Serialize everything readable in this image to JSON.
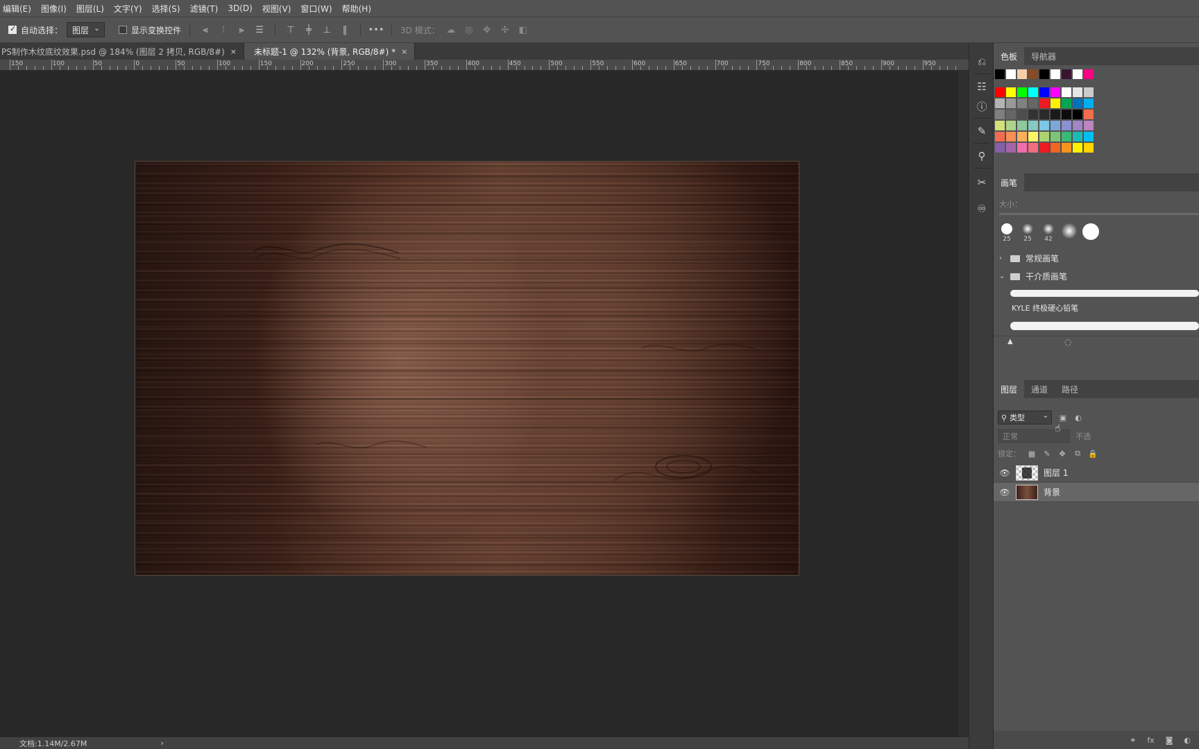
{
  "menu": [
    "编辑(E)",
    "图像(I)",
    "图层(L)",
    "文字(Y)",
    "选择(S)",
    "滤镜(T)",
    "3D(D)",
    "视图(V)",
    "窗口(W)",
    "帮助(H)"
  ],
  "options": {
    "auto_select_label": "自动选择：",
    "auto_select_value": "图层",
    "show_transform_label": "显示变换控件",
    "three_d_mode_label": "3D 模式："
  },
  "tabs": [
    {
      "label": "PS制作木纹底纹效果.psd @ 184% (图层 2 拷贝, RGB/8#)",
      "close": "×"
    },
    {
      "label": "未标题-1 @ 132% (背景, RGB/8#) *",
      "close": "×"
    }
  ],
  "ruler": [
    "150",
    "100",
    "50",
    "0",
    "50",
    "100",
    "150",
    "200",
    "250",
    "300",
    "350",
    "400",
    "450",
    "500",
    "550",
    "600",
    "650",
    "700",
    "750",
    "800",
    "850",
    "900",
    "950"
  ],
  "status": {
    "doc": "文档:1.14M/2.67M",
    "arrow": "›"
  },
  "swatch_panel": {
    "tabs": [
      "色板",
      "导航器"
    ]
  },
  "swatch_rows": [
    [
      "#000000",
      "#ffffff",
      "#f5cfa8",
      "#8a4a22",
      "#000000",
      "#ffffff",
      "#3a1530",
      "#ffffff",
      "#ff0080"
    ],
    [
      "#ff0000",
      "#ffff00",
      "#00ff00",
      "#00ffff",
      "#0000ff",
      "#ff00ff",
      "#ffffff",
      "#e6e6e6",
      "#cccccc"
    ],
    [
      "#b3b3b3",
      "#999999",
      "#808080",
      "#666666",
      "#ed1c24",
      "#fff200",
      "#00a651",
      "#0072bc",
      "#00aeef"
    ],
    [
      "#7f7f7f",
      "#666666",
      "#4d4d4d",
      "#333333",
      "#2a2a2a",
      "#1a1a1a",
      "#0d0d0d",
      "#000000",
      "#f26c4f"
    ],
    [
      "#d4e07a",
      "#acd48b",
      "#8dc99a",
      "#85c9c2",
      "#7ec7e6",
      "#7ea7d8",
      "#8c8fd0",
      "#a086c4",
      "#ba85c0"
    ],
    [
      "#f26c4f",
      "#f68e55",
      "#fbaf5c",
      "#fff467",
      "#acd372",
      "#7cc576",
      "#3bb878",
      "#1abbb4",
      "#00bff3"
    ],
    [
      "#8560a8",
      "#a763a8",
      "#f06eaa",
      "#f26d7d",
      "#ed1c24",
      "#f26522",
      "#f7941d",
      "#fff200",
      "#ffd400"
    ]
  ],
  "brush": {
    "tab": "画笔",
    "size_label": "大小：",
    "tips": [
      "25",
      "25",
      "42"
    ],
    "folder1": "常规画笔",
    "folder2": "干介质画笔",
    "brush_name": "KYLE 终极硬心铅笔"
  },
  "layers": {
    "tabs": [
      "图层",
      "通道",
      "路径"
    ],
    "filter": "类型",
    "blend": "正常",
    "opacity_label": "不透",
    "lock_label": "锁定：",
    "items": [
      {
        "name": "图层 1",
        "thumb": "checker",
        "selected": false
      },
      {
        "name": "背景",
        "thumb": "wood",
        "selected": true
      }
    ]
  }
}
